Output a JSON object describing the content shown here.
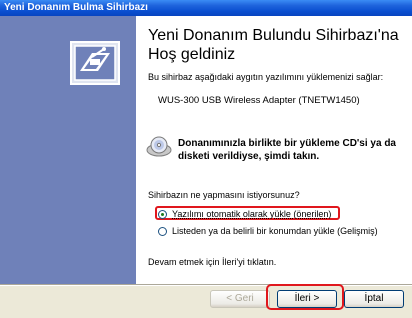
{
  "window": {
    "title": "Yeni Donanım Bulma Sihirbazı"
  },
  "wizard": {
    "heading": "Yeni Donanım Bulundu Sihirbazı'na Hoş geldiniz",
    "intro": "Bu sihirbaz aşağıdaki aygıtın yazılımını yüklemenizi sağlar:",
    "device_name": "WUS-300 USB Wireless Adapter (TNETW1450)",
    "cd_notice": "Donanımınızla birlikte bir yükleme CD'si ya da disketi verildiyse, şimdi takın.",
    "question": "Sihirbazın ne yapmasını istiyorsunuz?",
    "options": [
      {
        "label": "Yazılımı otomatik olarak yükle (önerilen)",
        "selected": true
      },
      {
        "label": "Listeden ya da belirli bir konumdan yükle (Gelişmiş)",
        "selected": false
      }
    ],
    "continue_text": "Devam etmek için İleri'yi tıklatın."
  },
  "buttons": {
    "back": "< Geri",
    "next": "İleri >",
    "cancel": "İptal"
  },
  "icons": [
    "wizard-hardware-icon",
    "cd-icon"
  ],
  "colors": {
    "sidebar": "#6f81b9",
    "highlight": "#e0171d",
    "titlebar": "#0a4fd0"
  }
}
